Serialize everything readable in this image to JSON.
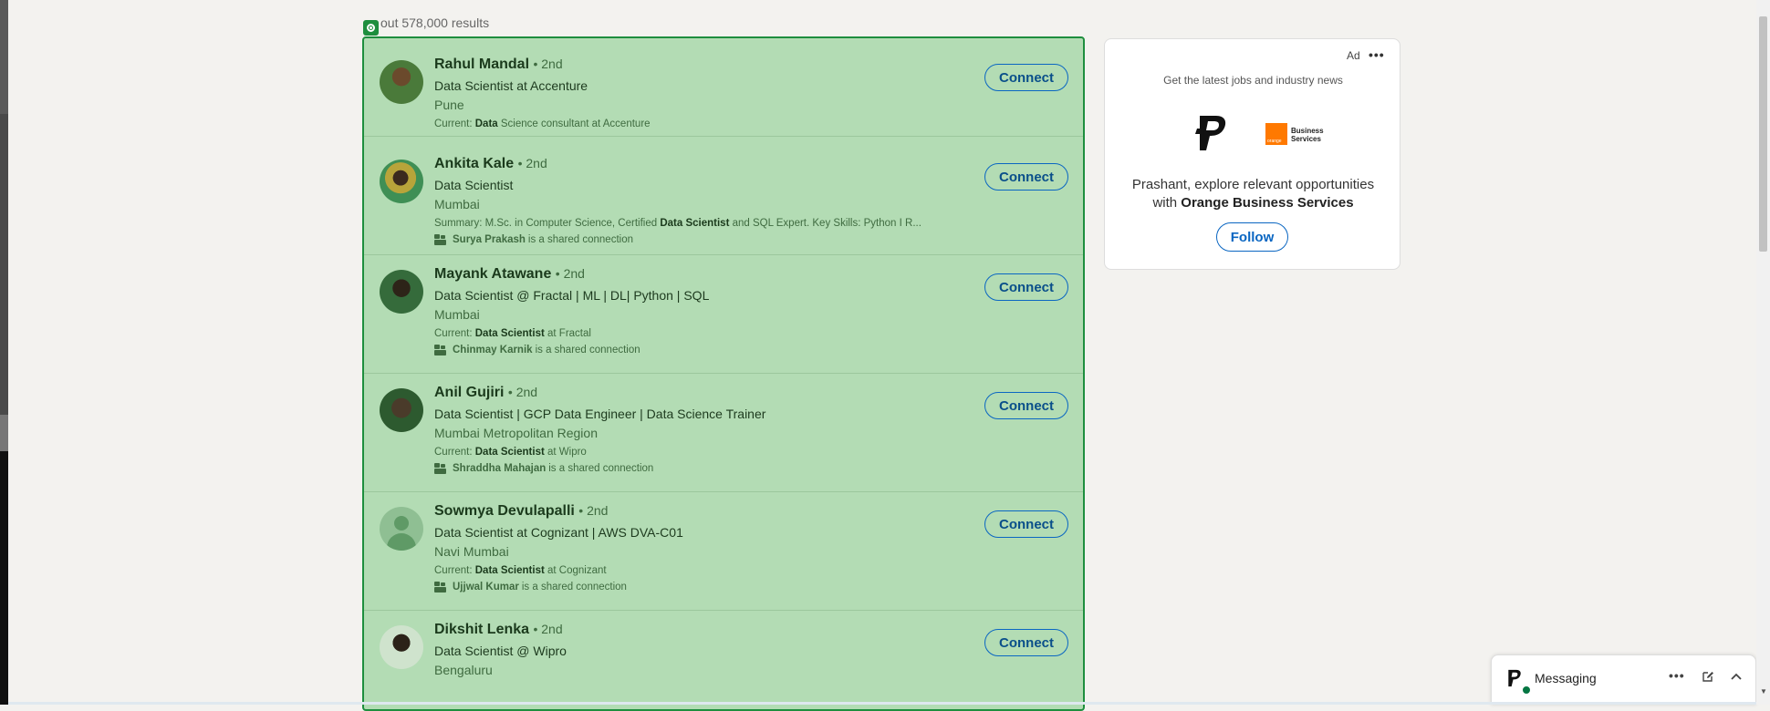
{
  "search": {
    "results_count": "out 578,000 results"
  },
  "results": [
    {
      "name": "Rahul Mandal",
      "degree": "• 2nd",
      "headline": "Data Scientist at Accenture",
      "location": "Pune",
      "summary_prefix": "Current: ",
      "summary_bold": "Data",
      "summary_rest": " Science consultant at Accenture",
      "shared_name": "",
      "shared_text": "",
      "button": "Connect"
    },
    {
      "name": "Ankita Kale",
      "degree": "• 2nd",
      "headline": "Data Scientist",
      "location": "Mumbai",
      "summary_prefix": "Summary: M.Sc. in Computer Science, Certified ",
      "summary_bold": "Data Scientist",
      "summary_rest": " and SQL Expert. Key Skills: Python I R...",
      "shared_name": "Surya Prakash",
      "shared_text": "is a shared connection",
      "button": "Connect"
    },
    {
      "name": "Mayank Atawane",
      "degree": "• 2nd",
      "headline": "Data Scientist @ Fractal | ML | DL| Python | SQL",
      "location": "Mumbai",
      "summary_prefix": "Current: ",
      "summary_bold": "Data Scientist",
      "summary_rest": " at Fractal",
      "shared_name": "Chinmay Karnik",
      "shared_text": "is a shared connection",
      "button": "Connect"
    },
    {
      "name": "Anil Gujiri",
      "degree": "• 2nd",
      "headline": "Data Scientist | GCP Data Engineer | Data Science Trainer",
      "location": "Mumbai Metropolitan Region",
      "summary_prefix": "Current: ",
      "summary_bold": "Data Scientist",
      "summary_rest": " at Wipro",
      "shared_name": "Shraddha Mahajan",
      "shared_text": "is a shared connection",
      "button": "Connect"
    },
    {
      "name": "Sowmya Devulapalli",
      "degree": "• 2nd",
      "headline": "Data Scientist at Cognizant | AWS DVA-C01",
      "location": "Navi Mumbai",
      "summary_prefix": "Current: ",
      "summary_bold": "Data Scientist",
      "summary_rest": " at Cognizant",
      "shared_name": "Ujjwal Kumar",
      "shared_text": "is a shared connection",
      "button": "Connect"
    },
    {
      "name": "Dikshit Lenka",
      "degree": "• 2nd",
      "headline": "Data Scientist @ Wipro",
      "location": "Bengaluru",
      "summary_prefix": "",
      "summary_bold": "",
      "summary_rest": "",
      "shared_name": "",
      "shared_text": "",
      "button": "Connect"
    }
  ],
  "ad": {
    "label": "Ad",
    "more": "•••",
    "tagline": "Get the latest jobs and industry news",
    "orange_logo_text": "orange",
    "company_logo_line1": "Business",
    "company_logo_line2": "Services",
    "copy_prefix": "Prashant, explore relevant opportunities with ",
    "copy_company": "Orange Business Services",
    "follow": "Follow"
  },
  "messaging": {
    "label": "Messaging",
    "more": "•••"
  },
  "colors": {
    "highlight_fill": "#b3dcb4",
    "highlight_border": "#1e8e3e",
    "link_blue": "#0a66c2",
    "brand_orange": "#ff7900",
    "online_green": "#057642"
  },
  "icons": {
    "marker": "target-marker-icon",
    "shared_connection": "people-icon",
    "ad_more": "ellipsis-icon",
    "messaging_compose": "compose-icon",
    "messaging_collapse": "chevron-up-icon"
  }
}
